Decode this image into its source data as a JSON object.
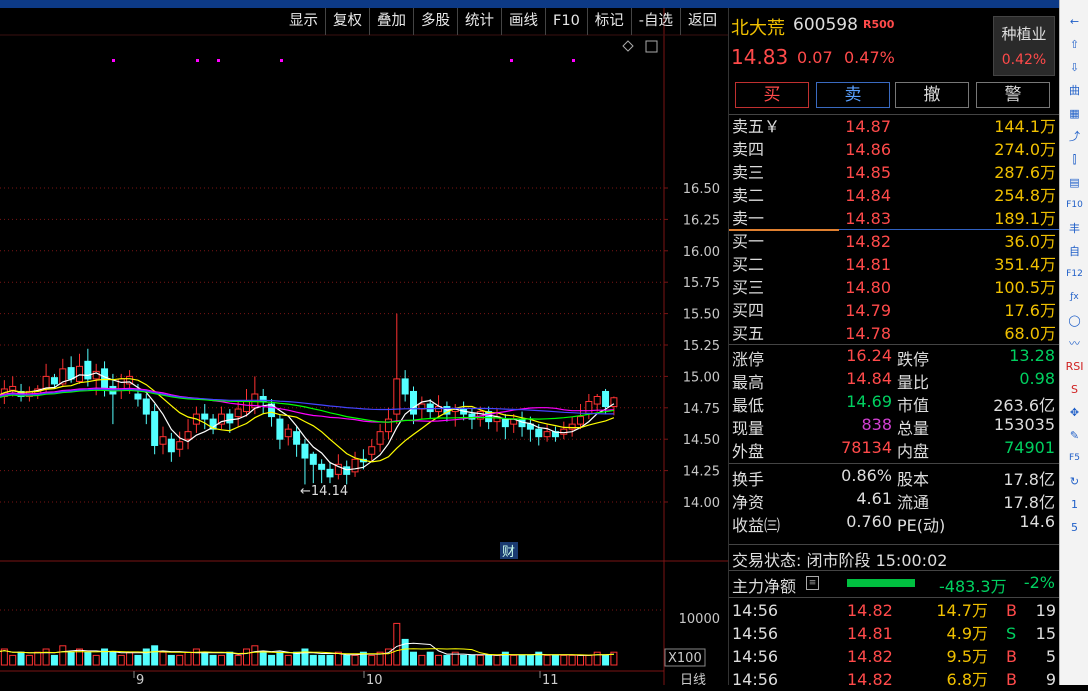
{
  "toolbar": {
    "items": [
      "显示",
      "复权",
      "叠加",
      "多股",
      "统计",
      "画线",
      "F10",
      "标记",
      "-自选",
      "返回"
    ]
  },
  "chart": {
    "price_axis": [
      {
        "v": 16.5,
        "l": "16.50"
      },
      {
        "v": 16.25,
        "l": "16.25"
      },
      {
        "v": 16.0,
        "l": "16.00"
      },
      {
        "v": 15.75,
        "l": "15.75"
      },
      {
        "v": 15.5,
        "l": "15.50"
      },
      {
        "v": 15.25,
        "l": "15.25"
      },
      {
        "v": 15.0,
        "l": "15.00"
      },
      {
        "v": 14.75,
        "l": "14.75"
      },
      {
        "v": 14.5,
        "l": "14.50"
      },
      {
        "v": 14.25,
        "l": "14.25"
      },
      {
        "v": 14.0,
        "l": "14.00"
      }
    ],
    "low_marker": "←14.14",
    "cai_badge": "财",
    "volume_label": "10000",
    "volume_unit": "X100",
    "x_labels": [
      "9",
      "10",
      "11"
    ],
    "period_label": "日线",
    "candles": [
      [
        14.8,
        14.84,
        14.97,
        14.62
      ],
      [
        14.84,
        14.9,
        14.97,
        14.78
      ],
      [
        14.89,
        14.92,
        15.0,
        14.84
      ],
      [
        14.88,
        14.84,
        14.94,
        14.8
      ],
      [
        14.84,
        14.88,
        14.92,
        14.8
      ],
      [
        14.86,
        14.9,
        14.93,
        14.82
      ],
      [
        14.9,
        15.0,
        15.1,
        14.86
      ],
      [
        14.99,
        14.94,
        15.02,
        14.9
      ],
      [
        14.94,
        15.06,
        15.14,
        14.92
      ],
      [
        15.07,
        14.98,
        15.16,
        14.95
      ],
      [
        14.96,
        15.08,
        15.18,
        14.94
      ],
      [
        15.12,
        14.98,
        15.22,
        14.92
      ],
      [
        14.98,
        15.04,
        15.1,
        14.85
      ],
      [
        15.06,
        14.9,
        15.12,
        14.84
      ],
      [
        14.92,
        14.86,
        15.02,
        14.62
      ],
      [
        14.9,
        14.98,
        15.02,
        14.82
      ],
      [
        14.94,
        15.0,
        15.05,
        14.86
      ],
      [
        14.86,
        14.82,
        14.94,
        14.76
      ],
      [
        14.82,
        14.7,
        14.86,
        14.62
      ],
      [
        14.72,
        14.45,
        14.78,
        14.38
      ],
      [
        14.46,
        14.52,
        14.6,
        14.38
      ],
      [
        14.5,
        14.4,
        14.55,
        14.32
      ],
      [
        14.42,
        14.48,
        14.56,
        14.36
      ],
      [
        14.5,
        14.56,
        14.66,
        14.42
      ],
      [
        14.62,
        14.7,
        14.76,
        14.55
      ],
      [
        14.7,
        14.66,
        14.78,
        14.58
      ],
      [
        14.66,
        14.58,
        14.7,
        14.54
      ],
      [
        14.62,
        14.7,
        14.76,
        14.58
      ],
      [
        14.7,
        14.63,
        14.74,
        14.55
      ],
      [
        14.68,
        14.74,
        14.8,
        14.6
      ],
      [
        14.72,
        14.8,
        14.9,
        14.68
      ],
      [
        14.75,
        14.86,
        15.0,
        14.7
      ],
      [
        14.84,
        14.8,
        14.9,
        14.7
      ],
      [
        14.78,
        14.68,
        14.82,
        14.6
      ],
      [
        14.66,
        14.5,
        14.7,
        14.42
      ],
      [
        14.52,
        14.58,
        14.62,
        14.45
      ],
      [
        14.56,
        14.46,
        14.6,
        14.36
      ],
      [
        14.46,
        14.35,
        14.5,
        14.14
      ],
      [
        14.38,
        14.3,
        14.4,
        14.15
      ],
      [
        14.3,
        14.26,
        14.34,
        14.15
      ],
      [
        14.26,
        14.2,
        14.32,
        14.15
      ],
      [
        14.22,
        14.3,
        14.38,
        14.18
      ],
      [
        14.28,
        14.22,
        14.33,
        14.14
      ],
      [
        14.24,
        14.34,
        14.4,
        14.2
      ],
      [
        14.34,
        14.32,
        14.42,
        14.26
      ],
      [
        14.38,
        14.44,
        14.5,
        14.32
      ],
      [
        14.46,
        14.56,
        14.62,
        14.4
      ],
      [
        14.56,
        14.66,
        14.75,
        14.5
      ],
      [
        14.7,
        14.98,
        15.5,
        14.62
      ],
      [
        14.98,
        14.86,
        15.05,
        14.8
      ],
      [
        14.88,
        14.7,
        14.92,
        14.62
      ],
      [
        14.74,
        14.78,
        14.84,
        14.66
      ],
      [
        14.78,
        14.72,
        14.82,
        14.66
      ],
      [
        14.72,
        14.76,
        14.85,
        14.68
      ],
      [
        14.76,
        14.7,
        14.8,
        14.64
      ],
      [
        14.72,
        14.74,
        14.78,
        14.6
      ],
      [
        14.74,
        14.7,
        14.8,
        14.65
      ],
      [
        14.7,
        14.66,
        14.74,
        14.58
      ],
      [
        14.66,
        14.72,
        14.76,
        14.6
      ],
      [
        14.72,
        14.64,
        14.76,
        14.58
      ],
      [
        14.64,
        14.68,
        14.74,
        14.56
      ],
      [
        14.66,
        14.6,
        14.7,
        14.5
      ],
      [
        14.62,
        14.66,
        14.7,
        14.55
      ],
      [
        14.66,
        14.6,
        14.72,
        14.52
      ],
      [
        14.62,
        14.58,
        14.68,
        14.48
      ],
      [
        14.58,
        14.52,
        14.62,
        14.45
      ],
      [
        14.52,
        14.56,
        14.62,
        14.48
      ],
      [
        14.56,
        14.52,
        14.6,
        14.48
      ],
      [
        14.54,
        14.58,
        14.64,
        14.5
      ],
      [
        14.58,
        14.62,
        14.68,
        14.52
      ],
      [
        14.62,
        14.68,
        14.78,
        14.58
      ],
      [
        14.7,
        14.8,
        14.86,
        14.66
      ],
      [
        14.78,
        14.84,
        14.86,
        14.72
      ],
      [
        14.88,
        14.76,
        14.9,
        14.7
      ],
      [
        14.76,
        14.83,
        14.84,
        14.69
      ]
    ],
    "volumes": [
      4,
      5,
      3,
      4,
      3,
      4,
      5,
      3,
      6,
      4,
      5,
      4,
      3,
      5,
      4,
      3,
      4,
      3,
      5,
      6,
      4,
      3,
      3,
      4,
      5,
      4,
      3,
      3,
      4,
      3,
      5,
      6,
      4,
      3,
      4,
      3,
      4,
      5,
      3,
      3,
      3,
      4,
      3,
      3,
      4,
      3,
      4,
      5,
      13,
      8,
      4,
      3,
      4,
      3,
      3,
      4,
      3,
      3,
      3,
      3,
      3,
      4,
      3,
      3,
      3,
      4,
      3,
      3,
      3,
      3,
      3,
      3,
      4,
      3,
      4
    ],
    "ma_colors": [
      "#ffffff",
      "#ffff00",
      "#ff00ff",
      "#00ff00",
      "#4444ff"
    ],
    "colors": {
      "up": "#ff3232",
      "down": "#54ffff",
      "grid": "#7a1515",
      "axis_text": "#c8c8c8",
      "marker": "#ff00ff"
    }
  },
  "quote": {
    "name": "北大荒",
    "code": "600598",
    "badge": "R500",
    "price": "14.83",
    "change": "0.07",
    "pct": "0.47%",
    "sector": "种植业",
    "sector_pct": "0.42%"
  },
  "actions": {
    "buy": "买",
    "sell": "卖",
    "cancel": "撤",
    "alert": "警"
  },
  "orderbook": {
    "asks": [
      {
        "label": "卖五￥",
        "price": "14.87",
        "vol": "144.1万"
      },
      {
        "label": "卖四",
        "price": "14.86",
        "vol": "274.0万"
      },
      {
        "label": "卖三",
        "price": "14.85",
        "vol": "287.6万"
      },
      {
        "label": "卖二",
        "price": "14.84",
        "vol": "254.8万"
      },
      {
        "label": "卖一",
        "price": "14.83",
        "vol": "189.1万"
      }
    ],
    "bids": [
      {
        "label": "买一",
        "price": "14.82",
        "vol": "36.0万"
      },
      {
        "label": "买二",
        "price": "14.81",
        "vol": "351.4万"
      },
      {
        "label": "买三",
        "price": "14.80",
        "vol": "100.5万"
      },
      {
        "label": "买四",
        "price": "14.79",
        "vol": "17.6万"
      },
      {
        "label": "买五",
        "price": "14.78",
        "vol": "68.0万"
      }
    ]
  },
  "stats": {
    "limit_up_l": "涨停",
    "limit_up": "16.24",
    "limit_down_l": "跌停",
    "limit_down": "13.28",
    "high_l": "最高",
    "high": "14.84",
    "vol_ratio_l": "量比",
    "vol_ratio": "0.98",
    "low_l": "最低",
    "low": "14.69",
    "mcap_l": "市值",
    "mcap": "263.6亿",
    "cur_vol_l": "现量",
    "cur_vol": "838",
    "total_vol_l": "总量",
    "total_vol": "153035",
    "outer_l": "外盘",
    "outer": "78134",
    "inner_l": "内盘",
    "inner": "74901",
    "turnover_l": "换手",
    "turnover": "0.86%",
    "shares_l": "股本",
    "shares": "17.8亿",
    "nav_l": "净资",
    "nav": "4.61",
    "float_l": "流通",
    "float": "17.8亿",
    "eps_l": "收益㈢",
    "eps": "0.760",
    "pe_l": "PE(动)",
    "pe": "14.6"
  },
  "status": "交易状态: 闭市阶段 15:00:02",
  "netflow": {
    "label": "主力净额",
    "value": "-483.3万",
    "pct": "-2%"
  },
  "ticks": [
    {
      "time": "14:56",
      "price": "14.82",
      "vol": "14.7万",
      "side": "B",
      "n": "19"
    },
    {
      "time": "14:56",
      "price": "14.81",
      "vol": "4.9万",
      "side": "S",
      "n": "15"
    },
    {
      "time": "14:56",
      "price": "14.82",
      "vol": "9.5万",
      "side": "B",
      "n": "5"
    },
    {
      "time": "14:56",
      "price": "14.82",
      "vol": "6.8万",
      "side": "B",
      "n": "9"
    }
  ],
  "sidebar_icons": [
    "←",
    "⇧",
    "⇩",
    "曲",
    "▦",
    "⤴",
    "⫿",
    "▤",
    "F10",
    "丰",
    "自",
    "F12",
    "ƒx",
    "◯",
    "〰",
    "RSI",
    "S",
    "✥",
    "✎",
    "F5",
    "↻",
    "1",
    "5"
  ]
}
